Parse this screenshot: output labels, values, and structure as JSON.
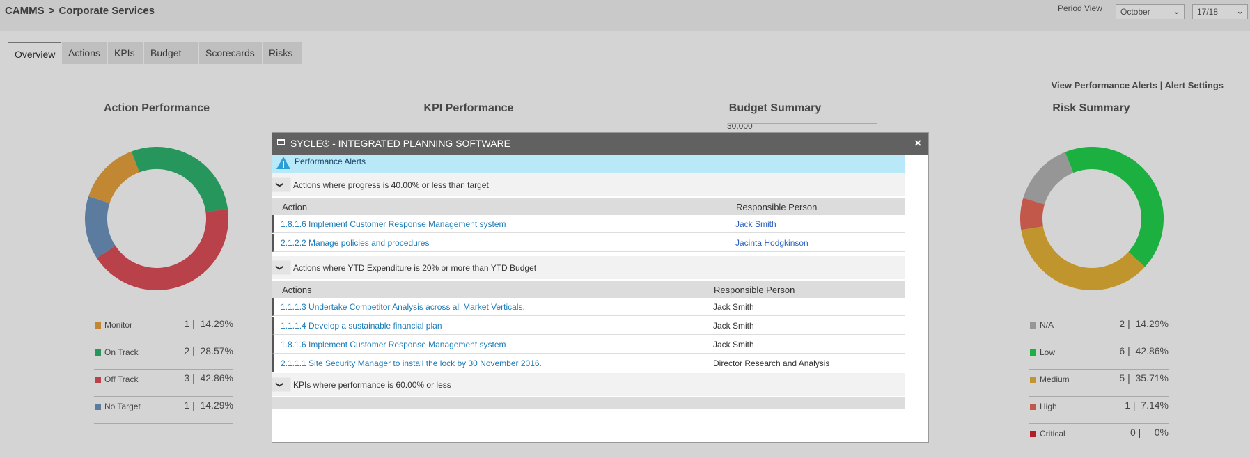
{
  "breadcrumb": {
    "root": "CAMMS",
    "separator": ">",
    "current": "Corporate Services"
  },
  "period": {
    "label": "Period View",
    "month": "October",
    "year": "17/18"
  },
  "tabs": [
    {
      "label": "Overview",
      "active": true
    },
    {
      "label": "Actions"
    },
    {
      "label": "KPIs"
    },
    {
      "label": "Budget"
    },
    {
      "label": "Scorecards"
    },
    {
      "label": "Risks"
    }
  ],
  "alert_links": {
    "view": "View Performance Alerts",
    "divider": "|",
    "settings": "Alert Settings"
  },
  "sections": {
    "action": "Action Performance",
    "kpi": "KPI Performance",
    "budget": "Budget Summary",
    "risk": "Risk Summary"
  },
  "budget_axis_label": "30,000",
  "action_legend": [
    {
      "label": "Monitor",
      "count": "1 |",
      "pct": "14.29%",
      "color": "#e8a33d"
    },
    {
      "label": "On Track",
      "count": "2 |",
      "pct": "28.57%",
      "color": "#2fb56f"
    },
    {
      "label": "Off Track",
      "count": "3 |",
      "pct": "42.86%",
      "color": "#df4f5a"
    },
    {
      "label": "No Target",
      "count": "1 |",
      "pct": "14.29%",
      "color": "#6f96c0"
    }
  ],
  "action_donut": [
    {
      "label": "Monitor",
      "value": 14.29,
      "color": "#e8a33d"
    },
    {
      "label": "On Track",
      "value": 28.57,
      "color": "#2fb56f"
    },
    {
      "label": "Off Track",
      "value": 42.86,
      "color": "#df4f5a"
    },
    {
      "label": "No Target",
      "value": 14.29,
      "color": "#6f96c0"
    }
  ],
  "risk_legend": [
    {
      "label": "N/A",
      "count": "2 |",
      "pct": "14.29%",
      "color": "#b5b5b5"
    },
    {
      "label": "Low",
      "count": "6 |",
      "pct": "42.86%",
      "color": "#22d44d"
    },
    {
      "label": "Medium",
      "count": "5 |",
      "pct": "35.71%",
      "color": "#e8b437"
    },
    {
      "label": "High",
      "count": "1 |",
      "pct": "7.14%",
      "color": "#e86a5a"
    },
    {
      "label": "Critical",
      "count": "0 |",
      "pct": "0%",
      "color": "#d9232e"
    }
  ],
  "risk_donut": [
    {
      "label": "Low",
      "value": 42.86,
      "color": "#22d44d"
    },
    {
      "label": "Medium",
      "value": 35.71,
      "color": "#e8b437"
    },
    {
      "label": "High",
      "value": 7.14,
      "color": "#e86a5a"
    },
    {
      "label": "N/A",
      "value": 14.29,
      "color": "#b5b5b5"
    }
  ],
  "modal": {
    "title": "SYCLE® - INTEGRATED PLANNING SOFTWARE",
    "close": "×",
    "banner": "Performance Alerts",
    "groups": [
      {
        "title": "Actions where progress is 40.00% or less than target",
        "col1": "Action",
        "col2": "Responsible Person",
        "rows": [
          {
            "action": "1.8.1.6 Implement Customer Response Management system",
            "person": "Jack Smith"
          },
          {
            "action": "2.1.2.2 Manage policies and procedures",
            "person": "Jacinta Hodgkinson"
          }
        ]
      },
      {
        "title": "Actions where YTD Expenditure is 20% or more than YTD Budget",
        "col1": "Actions",
        "col2": "Responsible Person",
        "rows": [
          {
            "action": "1.1.1.3 Undertake Competitor Analysis across all Market Verticals.",
            "person": "Jack Smith"
          },
          {
            "action": "1.1.1.4 Develop a sustainable financial plan",
            "person": "Jack Smith"
          },
          {
            "action": "1.8.1.6 Implement Customer Response Management system",
            "person": "Jack Smith"
          },
          {
            "action": "2.1.1.1 Site Security Manager to install the lock by 30 November 2016.",
            "person": "Director Research and Analysis"
          }
        ]
      },
      {
        "title": "KPIs where performance is 60.00% or less"
      }
    ]
  }
}
